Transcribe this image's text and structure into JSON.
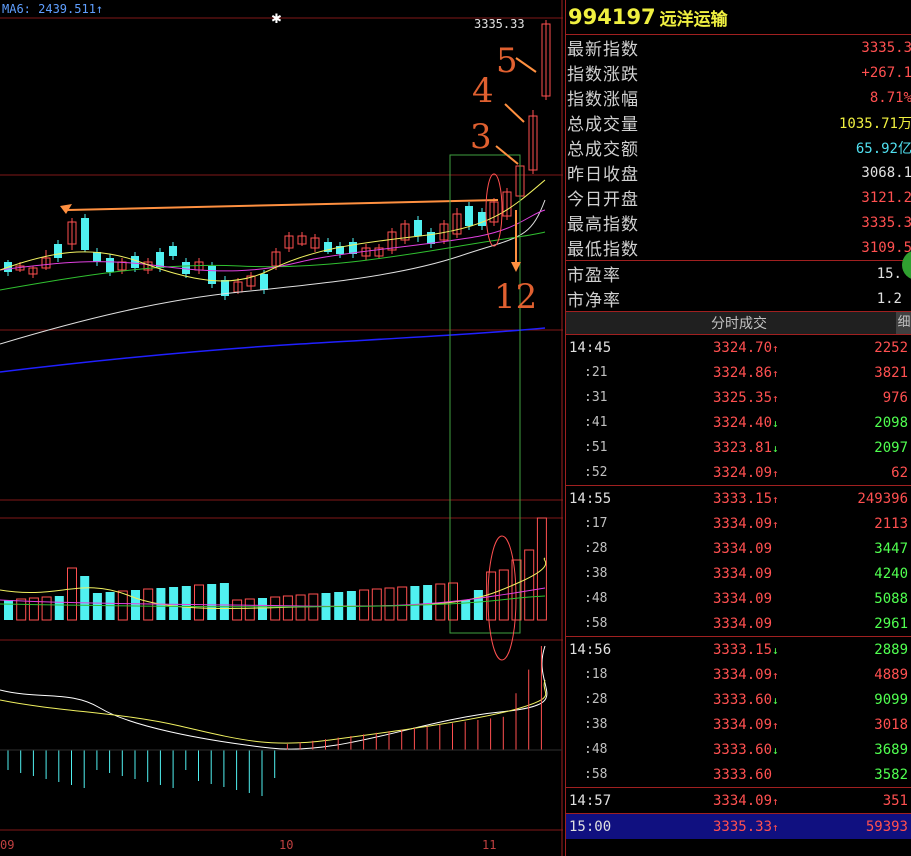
{
  "legend": {
    "text": "MA6: 2439.511↑"
  },
  "high_label": "3335.33",
  "x_dates": [
    "09",
    "10",
    "11"
  ],
  "annotations": [
    "3",
    "4",
    "5",
    "12"
  ],
  "stock": {
    "code": "994197",
    "name": "远洋运输"
  },
  "quotes": [
    {
      "label": "最新指数",
      "value": "3335.3",
      "color": "#ff5050"
    },
    {
      "label": "指数涨跌",
      "value": "+267.1",
      "color": "#ff5050"
    },
    {
      "label": "指数涨幅",
      "value": "8.71%",
      "color": "#ff5050"
    },
    {
      "label": "总成交量",
      "value": "1035.71万",
      "color": "#f0f040"
    },
    {
      "label": "总成交额",
      "value": "65.92亿",
      "color": "#50e0f0"
    },
    {
      "label": "昨日收盘",
      "value": "3068.1",
      "color": "#e0e0e0"
    },
    {
      "label": "今日开盘",
      "value": "3121.2",
      "color": "#ff5050"
    },
    {
      "label": "最高指数",
      "value": "3335.3",
      "color": "#ff5050"
    },
    {
      "label": "最低指数",
      "value": "3109.5",
      "color": "#ff5050"
    }
  ],
  "ratios": [
    {
      "label": "市盈率",
      "value": "15."
    },
    {
      "label": "市净率",
      "value": "1.2"
    }
  ],
  "ticks_header": {
    "title": "分时成交",
    "more": "细"
  },
  "ticks": [
    {
      "time": "14:45",
      "sub": false,
      "price": "3324.70",
      "dir": "up",
      "vol": "2252",
      "vcolor": "up",
      "sep": false
    },
    {
      "time": ":21",
      "sub": true,
      "price": "3324.86",
      "dir": "up",
      "vol": "3821",
      "vcolor": "up",
      "sep": false
    },
    {
      "time": ":31",
      "sub": true,
      "price": "3325.35",
      "dir": "up",
      "vol": "976",
      "vcolor": "up",
      "sep": false
    },
    {
      "time": ":41",
      "sub": true,
      "price": "3324.40",
      "dir": "down",
      "vol": "2098",
      "vcolor": "down",
      "sep": false
    },
    {
      "time": ":51",
      "sub": true,
      "price": "3323.81",
      "dir": "down",
      "vol": "2097",
      "vcolor": "down",
      "sep": false
    },
    {
      "time": ":52",
      "sub": true,
      "price": "3324.09",
      "dir": "up",
      "vol": "62",
      "vcolor": "up",
      "sep": false
    },
    {
      "time": "14:55",
      "sub": false,
      "price": "3333.15",
      "dir": "up",
      "vol": "249396",
      "vcolor": "up",
      "sep": true
    },
    {
      "time": ":17",
      "sub": true,
      "price": "3334.09",
      "dir": "up",
      "vol": "2113",
      "vcolor": "up",
      "sep": false
    },
    {
      "time": ":28",
      "sub": true,
      "price": "3334.09",
      "dir": "",
      "vol": "3447",
      "vcolor": "down",
      "sep": false
    },
    {
      "time": ":38",
      "sub": true,
      "price": "3334.09",
      "dir": "",
      "vol": "4240",
      "vcolor": "down",
      "sep": false
    },
    {
      "time": ":48",
      "sub": true,
      "price": "3334.09",
      "dir": "",
      "vol": "5088",
      "vcolor": "down",
      "sep": false
    },
    {
      "time": ":58",
      "sub": true,
      "price": "3334.09",
      "dir": "",
      "vol": "2961",
      "vcolor": "down",
      "sep": false
    },
    {
      "time": "14:56",
      "sub": false,
      "price": "3333.15",
      "dir": "down",
      "vol": "2889",
      "vcolor": "down",
      "sep": true
    },
    {
      "time": ":18",
      "sub": true,
      "price": "3334.09",
      "dir": "up",
      "vol": "4889",
      "vcolor": "up",
      "sep": false
    },
    {
      "time": ":28",
      "sub": true,
      "price": "3333.60",
      "dir": "down",
      "vol": "9099",
      "vcolor": "down",
      "sep": false
    },
    {
      "time": ":38",
      "sub": true,
      "price": "3334.09",
      "dir": "up",
      "vol": "3018",
      "vcolor": "up",
      "sep": false
    },
    {
      "time": ":48",
      "sub": true,
      "price": "3333.60",
      "dir": "down",
      "vol": "3689",
      "vcolor": "down",
      "sep": false
    },
    {
      "time": ":58",
      "sub": true,
      "price": "3333.60",
      "dir": "",
      "vol": "3582",
      "vcolor": "down",
      "sep": false
    },
    {
      "time": "14:57",
      "sub": false,
      "price": "3334.09",
      "dir": "up",
      "vol": "351",
      "vcolor": "up",
      "sep": true
    },
    {
      "time": "15:00",
      "sub": false,
      "price": "3335.33",
      "dir": "up",
      "vol": "59393",
      "vcolor": "up",
      "sep": true,
      "active": true
    }
  ],
  "colors": {
    "up": "#ff5050",
    "down": "#50ff50",
    "border": "#a02020",
    "bg": "#000000",
    "cyan": "#50f0f0"
  }
}
